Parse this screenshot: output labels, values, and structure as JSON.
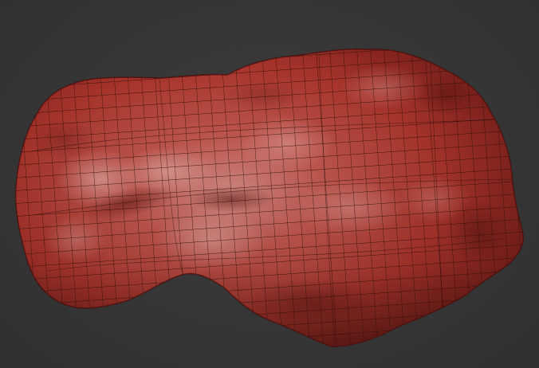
{
  "viewport": {
    "background_color": "#363636"
  },
  "model": {
    "kind": "sculpted-organic-mesh",
    "base_color": "#b5392f",
    "highlight_color": "#d98a84",
    "shadow_color": "#6e1a16",
    "wire_color": "#2a0a08",
    "wireframe_visible": true
  }
}
